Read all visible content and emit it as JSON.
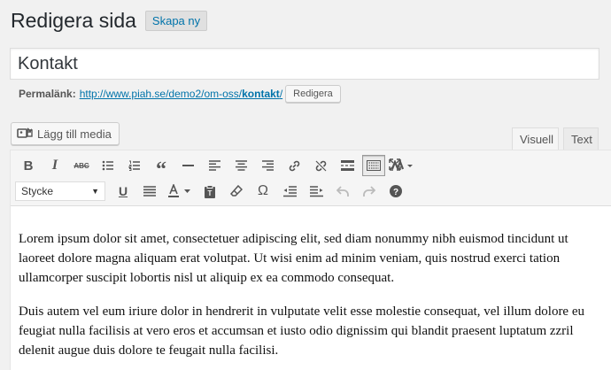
{
  "header": {
    "title": "Redigera sida",
    "add_new_label": "Skapa ny"
  },
  "title_field": {
    "value": "Kontakt"
  },
  "permalink": {
    "label": "Permalänk:",
    "url_base": "http://www.piah.se/demo2/om-oss/",
    "slug": "kontakt",
    "url_trail": "/",
    "edit_label": "Redigera"
  },
  "media": {
    "add_media_label": "Lägg till media"
  },
  "tabs": {
    "visual": "Visuell",
    "text": "Text"
  },
  "toolbar": {
    "format_select_value": "Stycke",
    "row1_icons": [
      "bold-icon",
      "italic-icon",
      "strikethrough-icon",
      "bullet-list-icon",
      "numbered-list-icon",
      "blockquote-icon",
      "horizontal-rule-icon",
      "align-left-icon",
      "align-center-icon",
      "align-right-icon",
      "link-icon",
      "unlink-icon",
      "read-more-icon",
      "toolbar-toggle-icon",
      "wp-logo-icon"
    ],
    "row2_icons": [
      "underline-icon",
      "justify-icon",
      "text-color-icon",
      "paste-text-icon",
      "clear-formatting-icon",
      "special-character-icon",
      "outdent-icon",
      "indent-icon",
      "undo-icon",
      "redo-icon",
      "help-icon"
    ],
    "fullscreen_icon": "fullscreen-icon"
  },
  "content": {
    "paragraphs": [
      "Lorem ipsum dolor sit amet, consectetuer adipiscing elit, sed diam nonummy nibh euismod tincidunt ut laoreet dolore magna aliquam erat volutpat. Ut wisi enim ad minim veniam, quis nostrud exerci tation ullamcorper suscipit lobortis nisl ut aliquip ex ea commodo consequat.",
      "Duis autem vel eum iriure dolor in hendrerit in vulputate velit esse molestie consequat, vel illum dolore eu feugiat nulla facilisis at vero eros et accumsan et iusto odio dignissim qui blandit praesent luptatum zzril delenit augue duis dolore te feugait nulla facilisi."
    ]
  }
}
